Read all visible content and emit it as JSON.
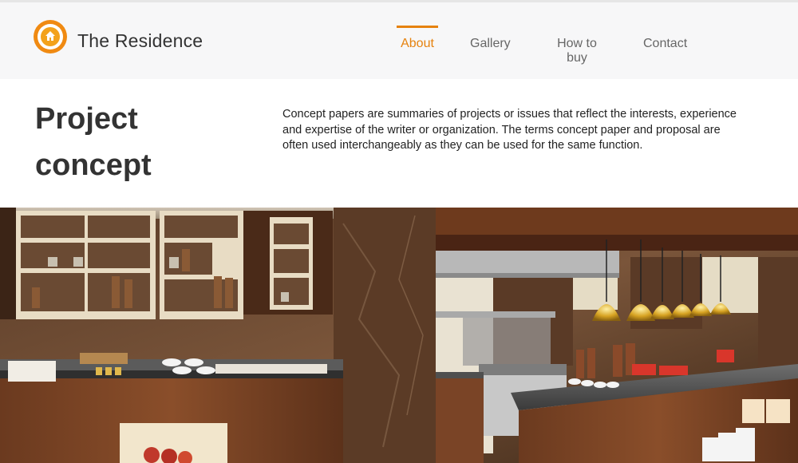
{
  "header": {
    "brand": "The Residence",
    "logo_icon": "house-icon",
    "accent_color": "#e6820e"
  },
  "nav": {
    "items": [
      {
        "label": "About",
        "active": true
      },
      {
        "label": "Gallery",
        "active": false
      },
      {
        "label": "How to buy",
        "active": false
      },
      {
        "label": "Contact",
        "active": false
      }
    ]
  },
  "main": {
    "title_line1": "Project",
    "title_line2": "concept",
    "description": "Concept papers are summaries of projects or issues that reflect the interests, experience and expertise of the writer or organization. The terms concept paper and proposal are often used interchangeably as they can be used for the same function."
  }
}
